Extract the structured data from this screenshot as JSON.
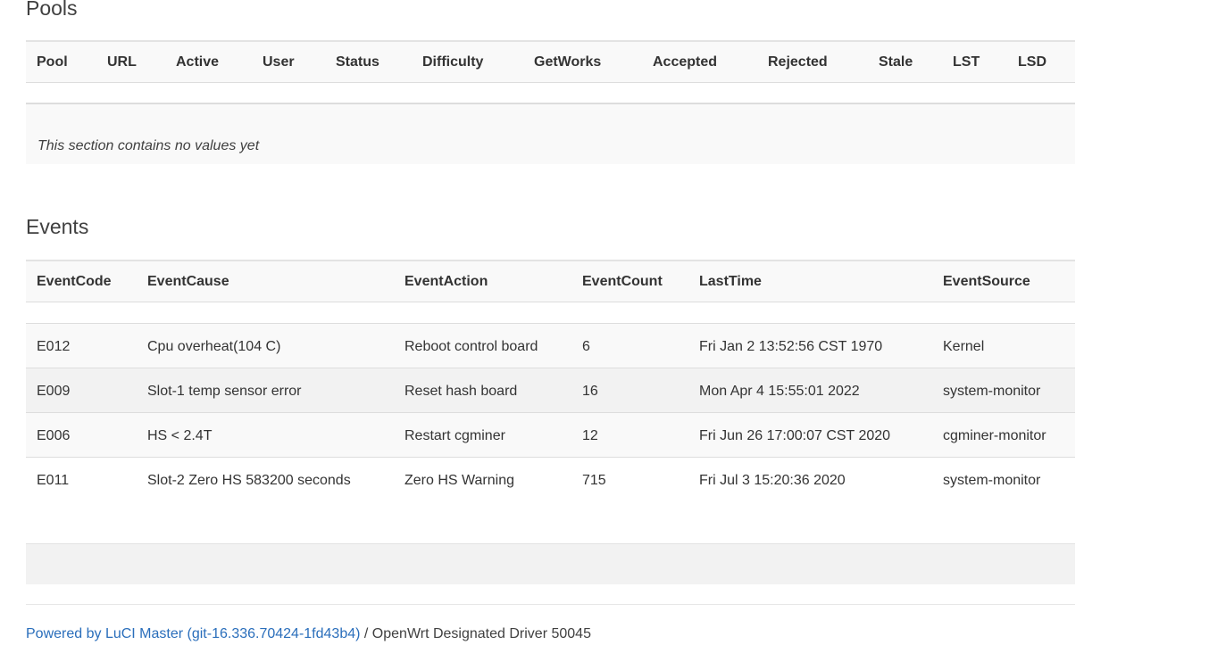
{
  "pools": {
    "title": "Pools",
    "columns": [
      "Pool",
      "URL",
      "Active",
      "User",
      "Status",
      "Difficulty",
      "GetWorks",
      "Accepted",
      "Rejected",
      "Stale",
      "LST",
      "LSD"
    ],
    "empty_text": "This section contains no values yet"
  },
  "events": {
    "title": "Events",
    "columns": [
      "EventCode",
      "EventCause",
      "EventAction",
      "EventCount",
      "LastTime",
      "EventSource"
    ],
    "rows": [
      [
        "E012",
        "Cpu overheat(104 C)",
        "Reboot control board",
        "6",
        "Fri Jan 2 13:52:56 CST 1970",
        "Kernel"
      ],
      [
        "E009",
        "Slot-1 temp sensor error",
        "Reset hash board",
        "16",
        "Mon Apr 4 15:55:01 2022",
        "system-monitor"
      ],
      [
        "E006",
        "HS < 2.4T",
        "Restart cgminer",
        "12",
        "Fri Jun 26 17:00:07 CST 2020",
        "cgminer-monitor"
      ],
      [
        "E011",
        "Slot-2 Zero HS 583200 seconds",
        "Zero HS Warning",
        "715",
        "Fri Jul 3 15:20:36 2020",
        "system-monitor"
      ]
    ]
  },
  "footer": {
    "link_text": "Powered by LuCI Master (git-16.336.70424-1fd43b4)",
    "separator": " / ",
    "version_text": "OpenWrt Designated Driver 50045"
  }
}
